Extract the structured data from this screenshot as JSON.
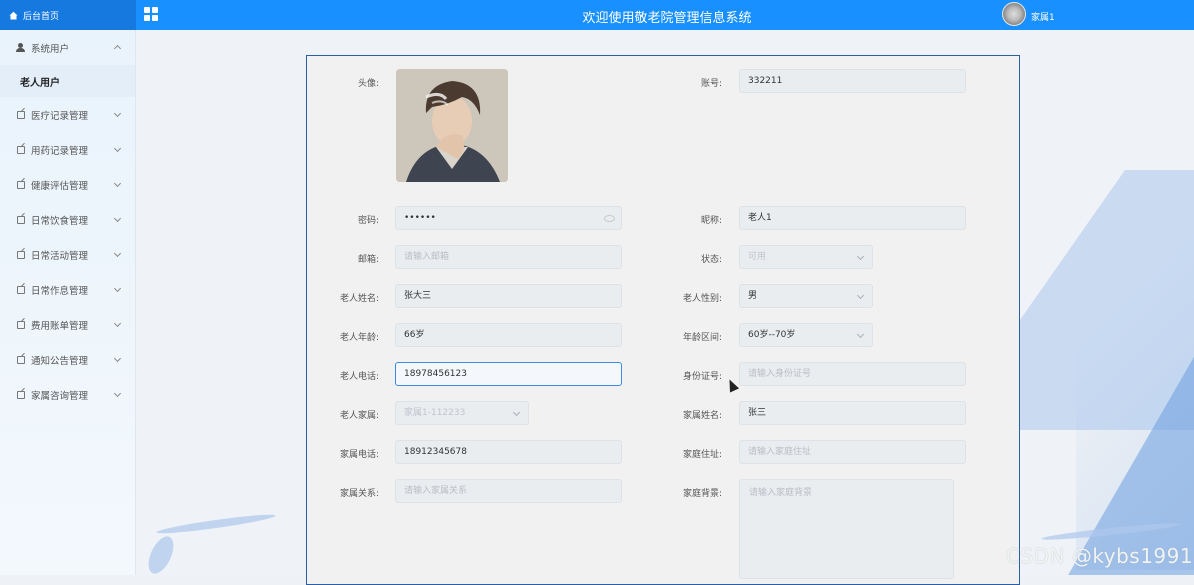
{
  "app": {
    "brand_label": "后台首页",
    "system_title": "欢迎使用敬老院管理信息系统",
    "username": "家属1"
  },
  "sidebar": {
    "items": [
      {
        "label": "系统用户",
        "expanded": true
      },
      {
        "label": "医疗记录管理"
      },
      {
        "label": "用药记录管理"
      },
      {
        "label": "健康评估管理"
      },
      {
        "label": "日常饮食管理"
      },
      {
        "label": "日常活动管理"
      },
      {
        "label": "日常作息管理"
      },
      {
        "label": "费用账单管理"
      },
      {
        "label": "通知公告管理"
      },
      {
        "label": "家属咨询管理"
      }
    ],
    "sub_item": "老人用户"
  },
  "form": {
    "avatar_label": "头像:",
    "account_label": "账号:",
    "account_value": "332211",
    "password_label": "密码:",
    "password_value": "••••••",
    "nickname_label": "昵称:",
    "nickname_value": "老人1",
    "email_label": "邮箱:",
    "email_placeholder": "请输入邮箱",
    "status_label": "状态:",
    "status_value": "可用",
    "name_label": "老人姓名:",
    "name_value": "张大三",
    "gender_label": "老人性别:",
    "gender_value": "男",
    "age_label": "老人年龄:",
    "age_value": "66岁",
    "age_range_label": "年龄区间:",
    "age_range_value": "60岁--70岁",
    "phone_label": "老人电话:",
    "phone_value": "18978456123",
    "idcard_label": "身份证号:",
    "idcard_placeholder": "请输入身份证号",
    "family_label": "老人家属:",
    "family_value": "家属1-112233",
    "family_name_label": "家属姓名:",
    "family_name_value": "张三",
    "family_phone_label": "家属电话:",
    "family_phone_value": "18912345678",
    "home_address_label": "家庭住址:",
    "home_address_placeholder": "请输入家庭住址",
    "relation_label": "家属关系:",
    "relation_placeholder": "请输入家属关系",
    "background_label": "家庭背景:",
    "background_placeholder": "请输入家庭背景"
  },
  "watermark": "CSDN @kybs1991",
  "colors": {
    "topbar": "#1890ff",
    "brand_bg": "#1679e0",
    "panel_border": "#2a5fa8",
    "focus_border": "#3e8ae3"
  },
  "icons": [
    "home-icon",
    "grid-menu-icon",
    "user-icon",
    "edit-icon",
    "chevron-down-icon",
    "chevron-up-icon",
    "eye-icon"
  ]
}
